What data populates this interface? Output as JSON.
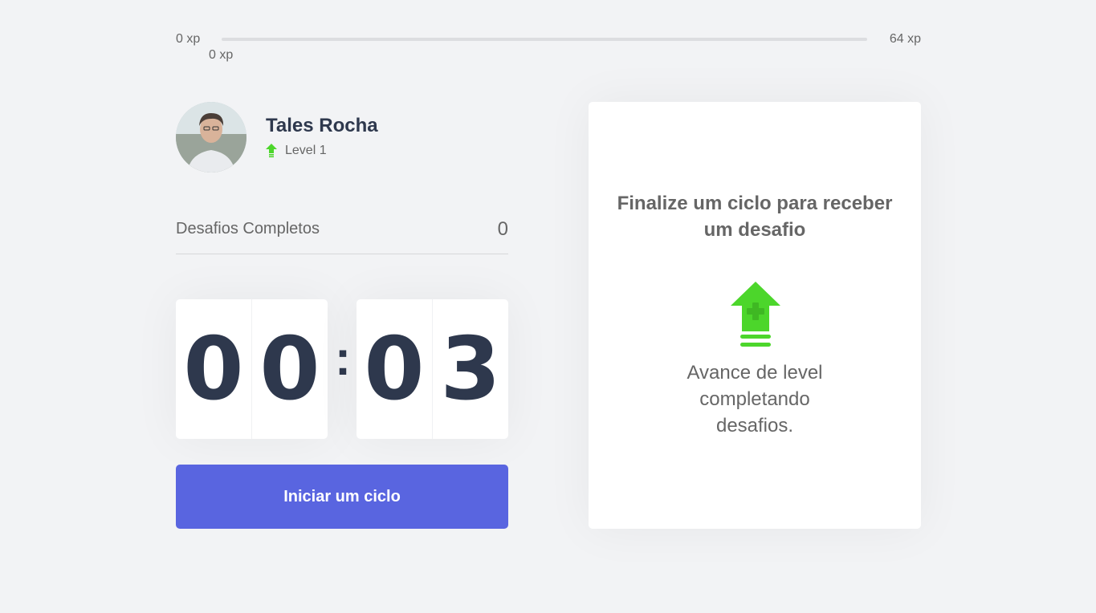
{
  "xp_bar": {
    "min_label": "0 xp",
    "max_label": "64 xp",
    "current_label": "0 xp",
    "progress_fraction": 0
  },
  "profile": {
    "name": "Tales Rocha",
    "level_label": "Level 1",
    "avatar_icon": "user-photo",
    "level_icon": "level-up-arrow-icon"
  },
  "challenges": {
    "completed_label": "Desafios Completos",
    "completed_count": "0"
  },
  "countdown": {
    "minute_left": "0",
    "minute_right": "0",
    "separator": ":",
    "second_left": "0",
    "second_right": "3"
  },
  "start_button": {
    "label": "Iniciar um ciclo"
  },
  "challenge_box": {
    "title": "Finalize um ciclo para receber um desafio",
    "description": "Avance de level completando desafios.",
    "icon": "level-up-icon"
  },
  "colors": {
    "background": "#f2f3f5",
    "primary": "#5965e0",
    "green": "#4cd62b",
    "title": "#2e384d",
    "text": "#666666"
  }
}
